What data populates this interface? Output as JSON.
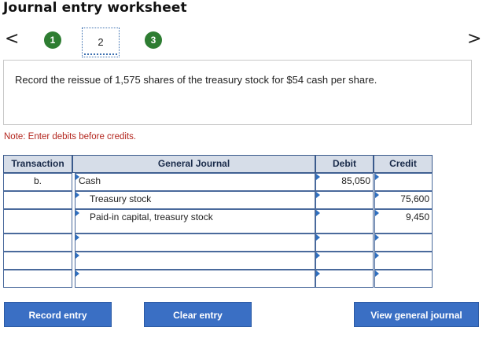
{
  "title": "Journal entry worksheet",
  "nav": {
    "prev_glyph": "<",
    "next_glyph": ">",
    "steps": [
      "1",
      "2",
      "3"
    ],
    "current_step": "2"
  },
  "question": "Record the reissue of 1,575 shares of the treasury stock for $54 cash per share.",
  "note": "Note: Enter debits before credits.",
  "table": {
    "headers": {
      "transaction": "Transaction",
      "general_journal": "General Journal",
      "debit": "Debit",
      "credit": "Credit"
    },
    "rows": [
      {
        "transaction": "b.",
        "account": "Cash",
        "debit": "85,050",
        "credit": ""
      },
      {
        "transaction": "",
        "account": "Treasury stock",
        "debit": "",
        "credit": "75,600"
      },
      {
        "transaction": "",
        "account": "Paid-in capital, treasury stock",
        "debit": "",
        "credit": "9,450"
      },
      {
        "transaction": "",
        "account": "",
        "debit": "",
        "credit": ""
      },
      {
        "transaction": "",
        "account": "",
        "debit": "",
        "credit": ""
      },
      {
        "transaction": "",
        "account": "",
        "debit": "",
        "credit": ""
      }
    ]
  },
  "buttons": {
    "record": "Record entry",
    "clear": "Clear entry",
    "view": "View general journal"
  },
  "colors": {
    "step_green": "#2e7d32",
    "header_bg": "#d6dde8",
    "button_blue": "#3a6fc4",
    "note_red": "#b3261e"
  }
}
